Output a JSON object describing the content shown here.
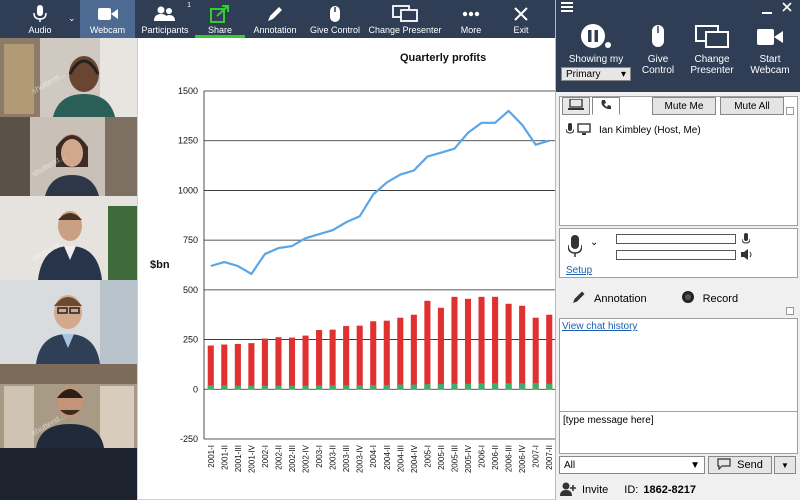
{
  "toolbar": {
    "audio": "Audio",
    "webcam": "Webcam",
    "participants": "Participants",
    "participants_count": "1",
    "share": "Share",
    "annotation": "Annotation",
    "give_control": "Give Control",
    "change_presenter": "Change Presenter",
    "more": "More",
    "exit": "Exit"
  },
  "video": {
    "watermark": "shutterst..."
  },
  "side": {
    "showing_my": "Showing my",
    "primary": "Primary",
    "give_control": [
      "Give",
      "Control"
    ],
    "change_presenter": [
      "Change",
      "Presenter"
    ],
    "start_webcam": [
      "Start",
      "Webcam"
    ],
    "mute_me": "Mute Me",
    "mute_all": "Mute All",
    "participant": "Ian Kimbley (Host, Me)",
    "setup": "Setup",
    "annotation": "Annotation",
    "record": "Record",
    "chat_history": "View chat history",
    "chat_placeholder": "[type message here]",
    "to": "All",
    "send": "Send",
    "invite": "Invite",
    "id_label": "ID:",
    "id_value": "1862-8217"
  },
  "colors": {
    "toolbar_bg": "#2f3e55",
    "active": "#4d6a92",
    "share_accent": "#33cc33",
    "line": "#5aa6e8",
    "bar_red": "#e03030",
    "bar_green": "#3fae6a"
  },
  "chart_data": {
    "type": "bar",
    "title": "Quarterly profits",
    "ylabel": "$bn",
    "xlabel": "",
    "ylim": [
      -250,
      1500
    ],
    "yticks": [
      -250,
      0,
      250,
      500,
      750,
      1000,
      1250,
      1500
    ],
    "categories": [
      "2001-I",
      "2001-II",
      "2001-III",
      "2001-IV",
      "2002-I",
      "2002-II",
      "2002-III",
      "2002-IV",
      "2003-I",
      "2003-II",
      "2003-III",
      "2003-IV",
      "2004-I",
      "2004-II",
      "2004-III",
      "2004-IV",
      "2005-I",
      "2005-II",
      "2005-III",
      "2005-IV",
      "2006-I",
      "2006-II",
      "2006-III",
      "2006-IV",
      "2007-I",
      "2007-II"
    ],
    "x_tick_labels": [
      "2001-I",
      "2001-III",
      "2002-I",
      "2002-III",
      "2003-I",
      "2003-III",
      "2004-I",
      "2004-III",
      "2005-I",
      "2005-III",
      "2006-I",
      "2006-III",
      "2007-I"
    ],
    "x_tick_labels_secondary": [
      "2001-II",
      "2001-IV",
      "2002-II",
      "2002-IV",
      "2003-II",
      "2003-IV",
      "2004-II",
      "2004-IV",
      "2005-II",
      "2005-IV",
      "2006-II",
      "2006-IV",
      "2007-II"
    ],
    "series": [
      {
        "type": "bar",
        "values": [
          220,
          225,
          228,
          232,
          255,
          262,
          260,
          270,
          298,
          300,
          318,
          320,
          342,
          345,
          360,
          375,
          445,
          410,
          465,
          455,
          465,
          465,
          430,
          420,
          360,
          375
        ]
      },
      {
        "type": "bar",
        "values": [
          20,
          20,
          18,
          18,
          18,
          18,
          18,
          18,
          20,
          20,
          20,
          20,
          22,
          22,
          24,
          24,
          26,
          26,
          28,
          28,
          30,
          30,
          30,
          30,
          32,
          28
        ]
      },
      {
        "type": "line",
        "values": [
          620,
          640,
          620,
          580,
          680,
          710,
          720,
          760,
          780,
          800,
          840,
          870,
          980,
          1040,
          1080,
          1100,
          1170,
          1190,
          1210,
          1290,
          1340,
          1340,
          1400,
          1330,
          1230,
          1250
        ]
      }
    ],
    "grid": true
  }
}
